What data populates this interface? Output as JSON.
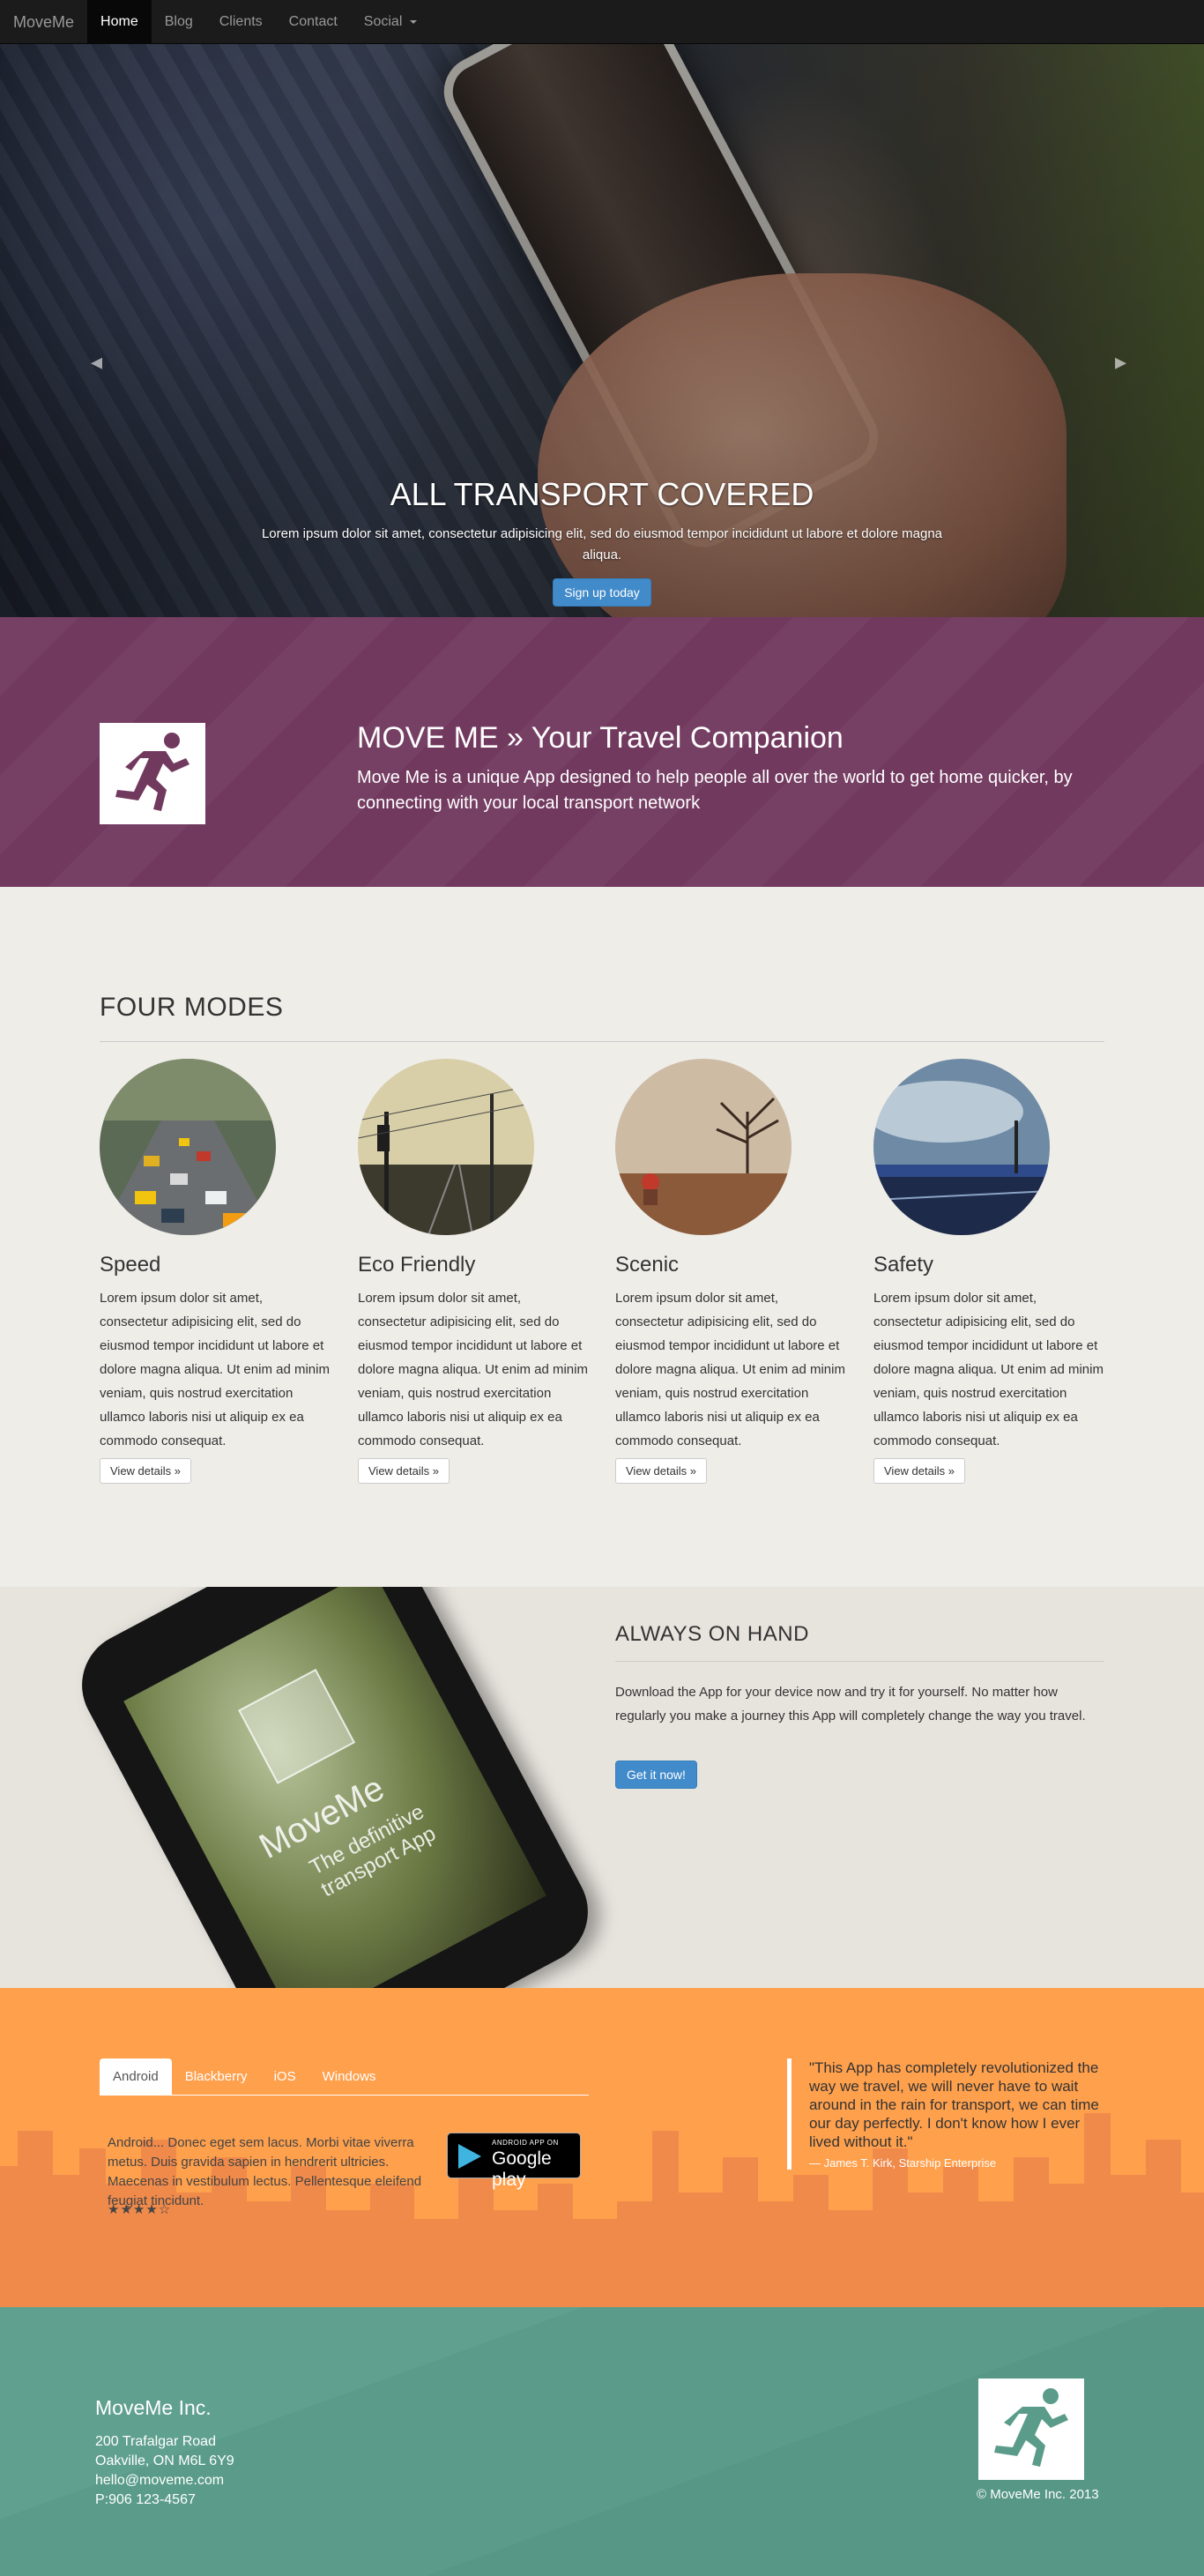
{
  "navbar": {
    "brand": "MoveMe",
    "items": [
      {
        "label": "Home"
      },
      {
        "label": "Blog"
      },
      {
        "label": "Clients"
      },
      {
        "label": "Contact"
      },
      {
        "label": "Social"
      }
    ]
  },
  "hero": {
    "prev_icon": "chevron-left-icon",
    "next_icon": "chevron-right-icon",
    "title": "ALL TRANSPORT COVERED",
    "text": "Lorem ipsum dolor sit amet, consectetur adipisicing elit, sed do eiusmod tempor incididunt ut labore et dolore magna aliqua.",
    "button": "Sign up today",
    "slide_count": 3,
    "active_slide": 2
  },
  "intro": {
    "logo_icon": "running-man-icon",
    "title": "MOVE ME » Your Travel Companion",
    "text": "Move Me is a unique App designed to help people all over the world to get home quicker, by connecting with your local transport network"
  },
  "modes": {
    "title": "FOUR MODES",
    "items": [
      {
        "title": "Speed",
        "text": "Lorem ipsum dolor sit amet, consectetur adipisicing elit, sed do eiusmod tempor incididunt ut labore et dolore magna aliqua. Ut enim ad minim veniam, quis nostrud exercitation ullamco laboris nisi ut aliquip ex ea commodo consequat.",
        "button": "View details »"
      },
      {
        "title": "Eco Friendly",
        "text": "Lorem ipsum dolor sit amet, consectetur adipisicing elit, sed do eiusmod tempor incididunt ut labore et dolore magna aliqua. Ut enim ad minim veniam, quis nostrud exercitation ullamco laboris nisi ut aliquip ex ea commodo consequat.",
        "button": "View details »"
      },
      {
        "title": "Scenic",
        "text": "Lorem ipsum dolor sit amet, consectetur adipisicing elit, sed do eiusmod tempor incididunt ut labore et dolore magna aliqua. Ut enim ad minim veniam, quis nostrud exercitation ullamco laboris nisi ut aliquip ex ea commodo consequat.",
        "button": "View details »"
      },
      {
        "title": "Safety",
        "text": "Lorem ipsum dolor sit amet, consectetur adipisicing elit, sed do eiusmod tempor incididunt ut labore et dolore magna aliqua. Ut enim ad minim veniam, quis nostrud exercitation ullamco laboris nisi ut aliquip ex ea commodo consequat.",
        "button": "View details »"
      }
    ]
  },
  "onhand": {
    "phone_brand": "MoveMe",
    "phone_tagline": "The definitive transport App",
    "title": "ALWAYS ON HAND",
    "text": "Download the App for your device now and try it for yourself. No matter how regularly you make a journey this App will completely change the way you travel.",
    "button": "Get it now!"
  },
  "download": {
    "tabs": [
      {
        "label": "Android"
      },
      {
        "label": "Blackberry"
      },
      {
        "label": "iOS"
      },
      {
        "label": "Windows"
      }
    ],
    "tab_text": "Android... Donec eget sem lacus. Morbi vitae viverra metus. Duis gravida sapien in hendrerit ultricies. Maecenas in vestibulum lectus. Pellentesque eleifend feugiat tincidunt.",
    "stars": "★★★★☆",
    "rating": 4,
    "badge_small": "ANDROID APP ON",
    "badge_big": "Google play",
    "quote": "\"This App has completely revolutionized the way we travel, we will never have to wait around in the rain for transport, we can time our day perfectly. I don't know how I ever lived without it.\"",
    "quote_author": "— James T. Kirk, Starship Enterprise"
  },
  "footer": {
    "company": "MoveMe Inc.",
    "address_lines": [
      "200 Trafalgar Road",
      "Oakville, ON M6L 6Y9",
      "hello@moveme.com",
      "P:906 123-4567"
    ],
    "copyright": "© MoveMe Inc. 2013"
  },
  "colors": {
    "navbar": "#1b1b1b",
    "purple_band": "#72395f",
    "modes_bg": "#eeede8",
    "onhand_bg": "#e7e4de",
    "orange": "#ffa04d",
    "skyline": "#f08a4b",
    "footer": "#5a9c89",
    "primary": "#428bca"
  }
}
